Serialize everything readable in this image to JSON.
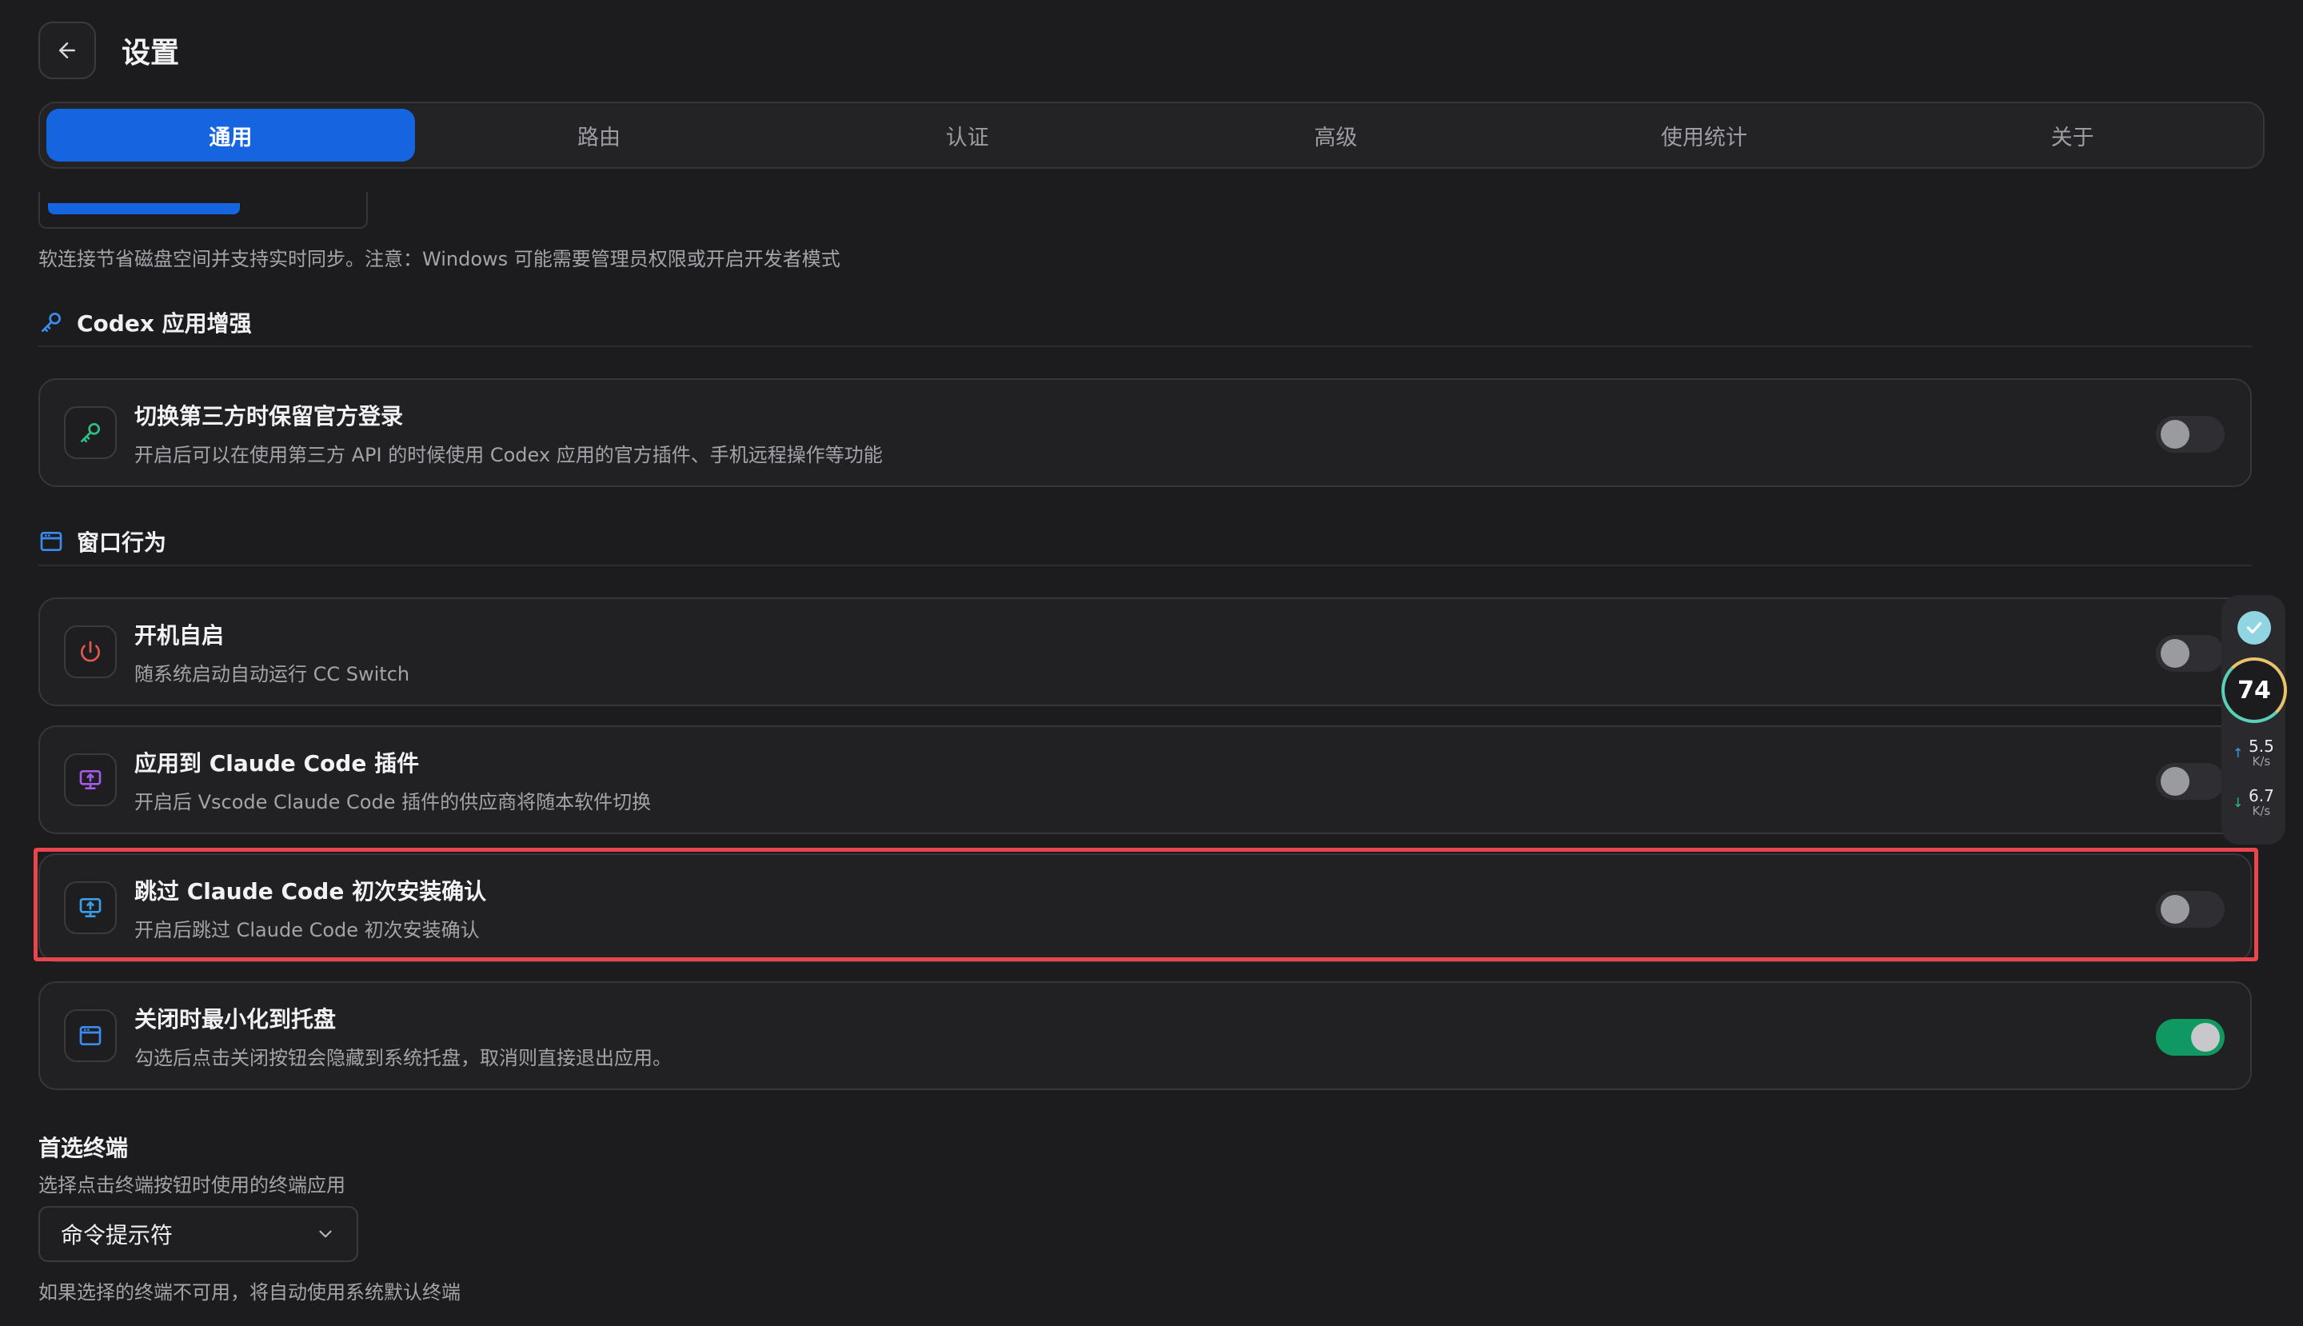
{
  "header": {
    "title": "设置"
  },
  "tabs": [
    {
      "label": "通用"
    },
    {
      "label": "路由"
    },
    {
      "label": "认证"
    },
    {
      "label": "高级"
    },
    {
      "label": "使用统计"
    },
    {
      "label": "关于"
    }
  ],
  "symlink_hint": "软连接节省磁盘空间并支持实时同步。注意：Windows 可能需要管理员权限或开启开发者模式",
  "sections": {
    "codex": {
      "label": "Codex 应用增强"
    },
    "window": {
      "label": "窗口行为"
    }
  },
  "settings": {
    "keep_login": {
      "title": "切换第三方时保留官方登录",
      "desc": "开启后可以在使用第三方 API 的时候使用 Codex 应用的官方插件、手机远程操作等功能",
      "enabled": false
    },
    "autostart": {
      "title": "开机自启",
      "desc": "随系统启动自动运行 CC Switch",
      "enabled": false
    },
    "claude_plugin": {
      "title": "应用到 Claude Code 插件",
      "desc": "开启后 Vscode Claude Code 插件的供应商将随本软件切换",
      "enabled": false
    },
    "skip_confirm": {
      "title": "跳过 Claude Code 初次安装确认",
      "desc": "开启后跳过 Claude Code 初次安装确认",
      "enabled": false
    },
    "minimize_tray": {
      "title": "关闭时最小化到托盘",
      "desc": "勾选后点击关闭按钮会隐藏到系统托盘，取消则直接退出应用。",
      "enabled": true
    }
  },
  "terminal": {
    "title": "首选终端",
    "desc": "选择点击终端按钮时使用的终端应用",
    "selected": "命令提示符",
    "fallback_hint": "如果选择的终端不可用，将自动使用系统默认终端"
  },
  "widget": {
    "score": "74",
    "upload_speed": "5.5",
    "upload_unit": "K/s",
    "download_speed": "6.7",
    "download_unit": "K/s"
  },
  "colors": {
    "accent": "#1565e0",
    "toggle_on": "#0f9960",
    "highlight": "#e8454d",
    "background": "#1c1c1f"
  }
}
